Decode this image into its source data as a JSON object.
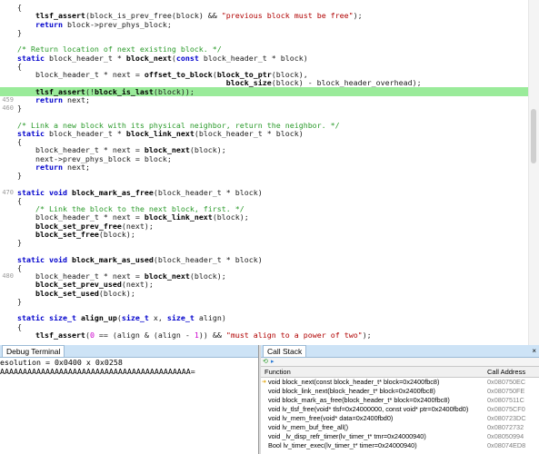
{
  "editor": {
    "lines": [
      {
        "num": "",
        "html": "{"
      },
      {
        "num": "",
        "html": "    <span class=\"bd\">tlsf_assert</span>(block_is_prev_free(block) &amp;&amp; <span class=\"st\">\"previous block must be free\"</span>);"
      },
      {
        "num": "",
        "html": "    <span class=\"kw\">return</span> block-&gt;prev_phys_block;"
      },
      {
        "num": "",
        "html": "}"
      },
      {
        "num": "",
        "html": ""
      },
      {
        "num": "",
        "html": "<span class=\"cm\">/* Return location of next existing block. */</span>"
      },
      {
        "num": "",
        "html": "<span class=\"kw\">static</span> block_header_t * <span class=\"bd\">block_next</span>(<span class=\"kw\">const</span> block_header_t * block)"
      },
      {
        "num": "",
        "html": "{"
      },
      {
        "num": "",
        "html": "    block_header_t * next = <span class=\"bd\">offset_to_block</span>(<span class=\"bd\">block_to_ptr</span>(block),"
      },
      {
        "num": "",
        "html": "                                              <span class=\"bd\">block_size</span>(block) - block_header_overhead);"
      },
      {
        "num": "",
        "html": "    <span class=\"bd\">tlsf_assert</span>(!<span class=\"bd\">block_is_last</span>(block));",
        "hl": true
      },
      {
        "num": "459",
        "html": "    <span class=\"kw\">return</span> next;"
      },
      {
        "num": "460",
        "html": "}"
      },
      {
        "num": "",
        "html": ""
      },
      {
        "num": "",
        "html": "<span class=\"cm\">/* Link a new block with its physical neighbor, return the neighbor. */</span>"
      },
      {
        "num": "",
        "html": "<span class=\"kw\">static</span> block_header_t * <span class=\"bd\">block_link_next</span>(block_header_t * block)"
      },
      {
        "num": "",
        "html": "{"
      },
      {
        "num": "",
        "html": "    block_header_t * next = <span class=\"bd\">block_next</span>(block);"
      },
      {
        "num": "",
        "html": "    next-&gt;prev_phys_block = block;"
      },
      {
        "num": "",
        "html": "    <span class=\"kw\">return</span> next;"
      },
      {
        "num": "",
        "html": "}"
      },
      {
        "num": "",
        "html": ""
      },
      {
        "num": "470",
        "html": "<span class=\"kw\">static void</span> <span class=\"bd\">block_mark_as_free</span>(block_header_t * block)"
      },
      {
        "num": "",
        "html": "{"
      },
      {
        "num": "",
        "html": "    <span class=\"cm\">/* Link the block to the next block, first. */</span>"
      },
      {
        "num": "",
        "html": "    block_header_t * next = <span class=\"bd\">block_link_next</span>(block);"
      },
      {
        "num": "",
        "html": "    <span class=\"bd\">block_set_prev_free</span>(next);"
      },
      {
        "num": "",
        "html": "    <span class=\"bd\">block_set_free</span>(block);"
      },
      {
        "num": "",
        "html": "}"
      },
      {
        "num": "",
        "html": ""
      },
      {
        "num": "",
        "html": "<span class=\"kw\">static void</span> <span class=\"bd\">block_mark_as_used</span>(block_header_t * block)"
      },
      {
        "num": "",
        "html": "{"
      },
      {
        "num": "480",
        "html": "    block_header_t * next = <span class=\"bd\">block_next</span>(block);"
      },
      {
        "num": "",
        "html": "    <span class=\"bd\">block_set_prev_used</span>(next);"
      },
      {
        "num": "",
        "html": "    <span class=\"bd\">block_set_used</span>(block);"
      },
      {
        "num": "",
        "html": "}"
      },
      {
        "num": "",
        "html": ""
      },
      {
        "num": "",
        "html": "<span class=\"kw\">static size_t</span> <span class=\"bd\">align_up</span>(<span class=\"kw\">size_t</span> x, <span class=\"kw\">size_t</span> align)"
      },
      {
        "num": "",
        "html": "{"
      },
      {
        "num": "",
        "html": "    <span class=\"bd\">tlsf_assert</span>(<span class=\"mg\">0</span> == (align &amp; (align - <span class=\"mg\">1</span>)) &amp;&amp; <span class=\"st\">\"must align to a power of two\"</span>);"
      }
    ],
    "highlight_color": "#9aeb9a"
  },
  "debug_terminal": {
    "title": "Debug Terminal",
    "lines": [
      "esolution = 0x0400 x 0x0258",
      "AAAAAAAAAAAAAAAAAAAAAAAAAAAAAAAAAAAAAAAAAA="
    ]
  },
  "call_stack": {
    "title": "Call Stack",
    "close_icon": "×",
    "columns": {
      "function": "Function",
      "address": "Call Address"
    },
    "rows": [
      {
        "fn": "void block_next(const block_header_t* block=0x2400fbc8)",
        "addr": "0x080750EC",
        "current": true
      },
      {
        "fn": "void block_link_next(block_header_t* block=0x2400fbc8)",
        "addr": "0x080750FE"
      },
      {
        "fn": "void block_mark_as_free(block_header_t* block=0x2400fbc8)",
        "addr": "0x0807511C"
      },
      {
        "fn": "void lv_tlsf_free(void* tlsf=0x24000000, const void* ptr=0x2400fbd0)",
        "addr": "0x08075CF0"
      },
      {
        "fn": "void lv_mem_free(void* data=0x2400fbd0)",
        "addr": "0x080723DC"
      },
      {
        "fn": "void lv_mem_buf_free_all()",
        "addr": "0x08072732"
      },
      {
        "fn": "void _lv_disp_refr_timer(lv_timer_t* tmr=0x24000940)",
        "addr": "0x08050994"
      },
      {
        "fn": "Bool lv_timer_exec(lv_timer_t* timer=0x24000940)",
        "addr": "0x08074ED8"
      }
    ]
  }
}
